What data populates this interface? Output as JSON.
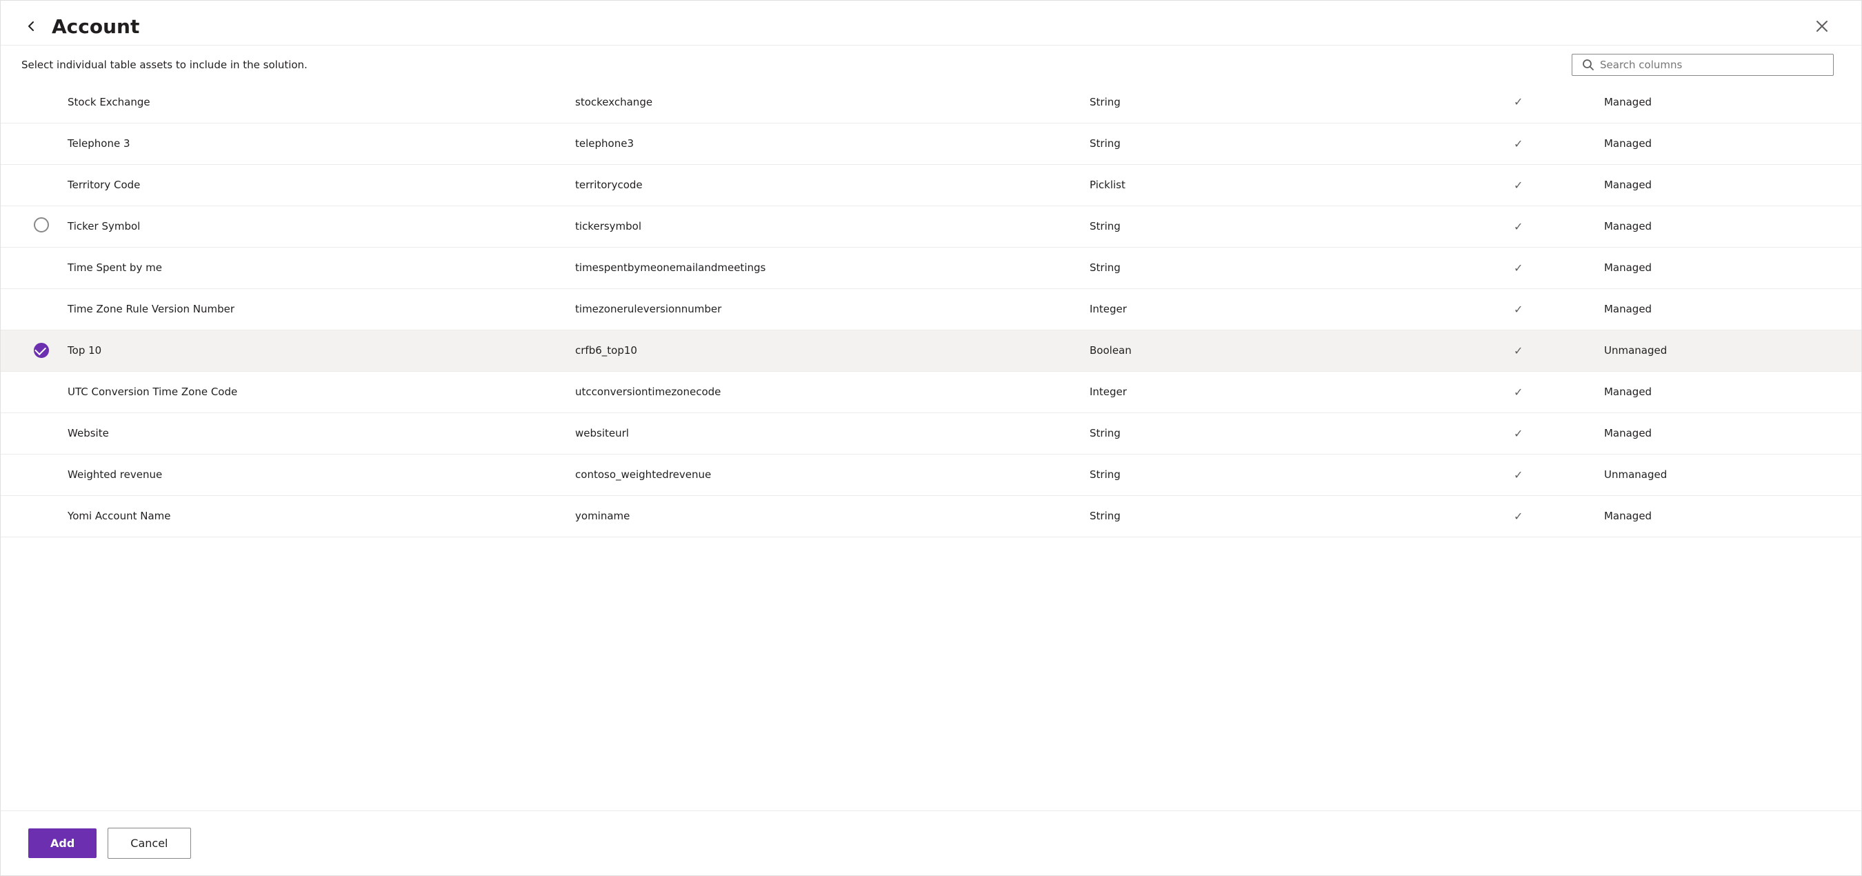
{
  "dialog": {
    "title": "Account",
    "subtitle_plain": "Select individual table assets to include in the solution.",
    "subtitle_highlight_words": [
      "individual",
      "table",
      "assets",
      "to",
      "include"
    ],
    "close_label": "Close",
    "back_label": "Back"
  },
  "search": {
    "placeholder": "Search columns"
  },
  "footer": {
    "add_label": "Add",
    "cancel_label": "Cancel"
  },
  "rows": [
    {
      "id": 1,
      "name": "Stock Exchange",
      "logical": "stockexchange",
      "type": "String",
      "hasCheck": true,
      "status": "Managed",
      "selected": false
    },
    {
      "id": 2,
      "name": "Telephone 3",
      "logical": "telephone3",
      "type": "String",
      "hasCheck": true,
      "status": "Managed",
      "selected": false
    },
    {
      "id": 3,
      "name": "Territory Code",
      "logical": "territorycode",
      "type": "Picklist",
      "hasCheck": true,
      "status": "Managed",
      "selected": false
    },
    {
      "id": 4,
      "name": "Ticker Symbol",
      "logical": "tickersymbol",
      "type": "String",
      "hasCheck": true,
      "status": "Managed",
      "selected": false,
      "circleUnchecked": true
    },
    {
      "id": 5,
      "name": "Time Spent by me",
      "logical": "timespentbymeonemailandmeetings",
      "type": "String",
      "hasCheck": true,
      "status": "Managed",
      "selected": false
    },
    {
      "id": 6,
      "name": "Time Zone Rule Version Number",
      "logical": "timezoneruleversionnumber",
      "type": "Integer",
      "hasCheck": true,
      "status": "Managed",
      "selected": false
    },
    {
      "id": 7,
      "name": "Top 10",
      "logical": "crfb6_top10",
      "type": "Boolean",
      "hasCheck": true,
      "status": "Unmanaged",
      "selected": true
    },
    {
      "id": 8,
      "name": "UTC Conversion Time Zone Code",
      "logical": "utcconversiontimezonecode",
      "type": "Integer",
      "hasCheck": true,
      "status": "Managed",
      "selected": false
    },
    {
      "id": 9,
      "name": "Website",
      "logical": "websiteurl",
      "type": "String",
      "hasCheck": true,
      "status": "Managed",
      "selected": false
    },
    {
      "id": 10,
      "name": "Weighted revenue",
      "logical": "contoso_weightedrevenue",
      "type": "String",
      "hasCheck": true,
      "status": "Unmanaged",
      "selected": false
    },
    {
      "id": 11,
      "name": "Yomi Account Name",
      "logical": "yominame",
      "type": "String",
      "hasCheck": true,
      "status": "Managed",
      "selected": false
    }
  ]
}
